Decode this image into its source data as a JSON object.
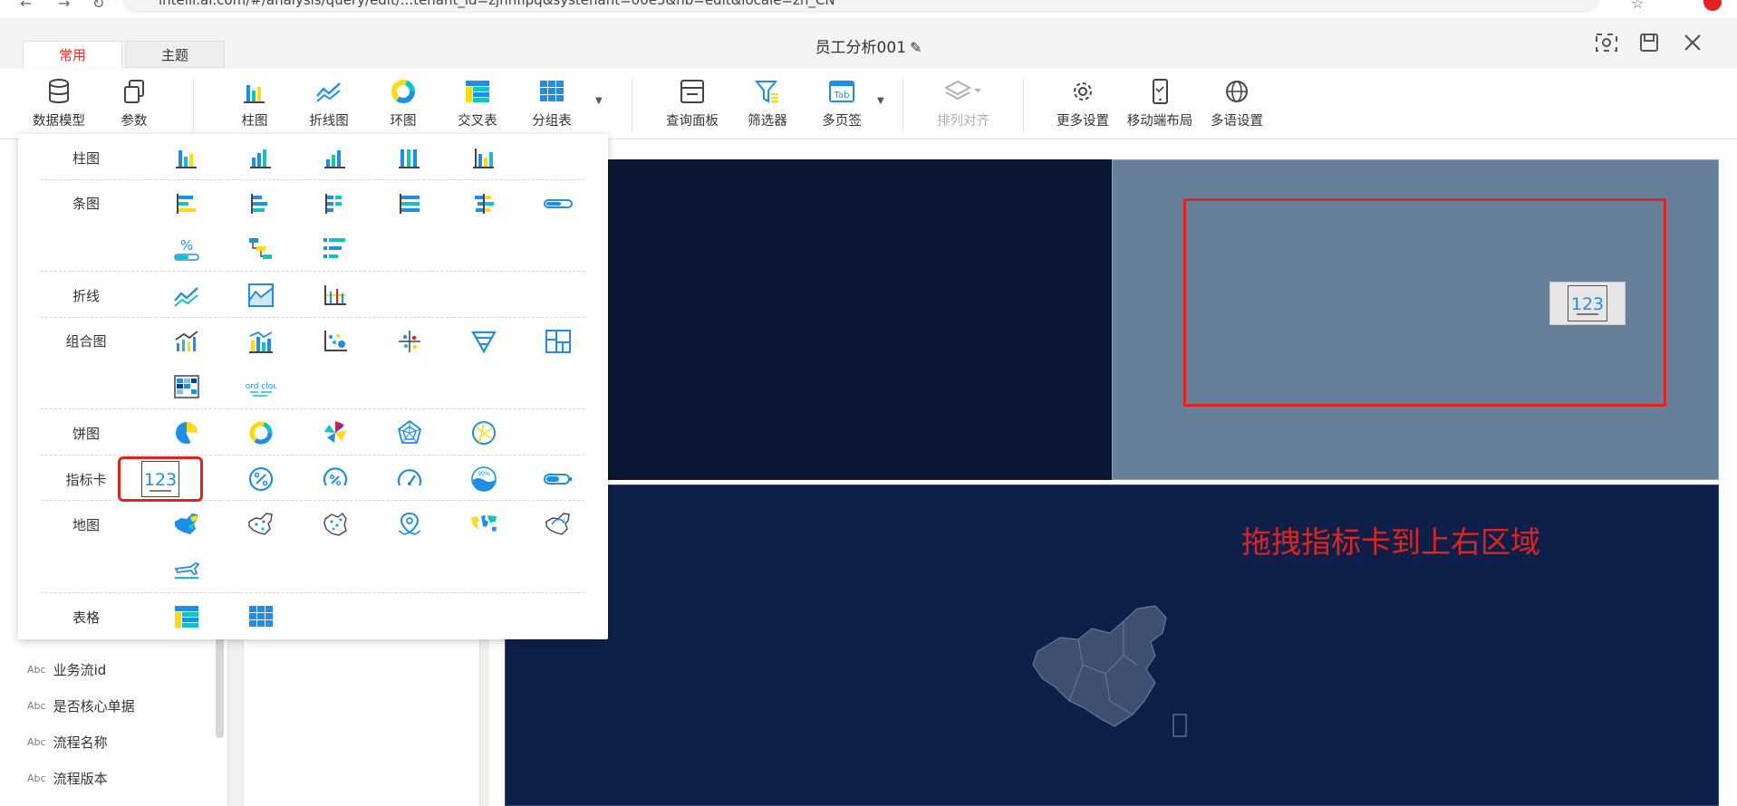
{
  "browser": {
    "url_text": "intelli.ai.com/#/analysis/query/edit/...tenant_id=zjhhfipq&systenant=00e5&nb=edit&locale=zh_CN"
  },
  "tabs": [
    {
      "label": "常用",
      "active": true
    },
    {
      "label": "主题",
      "active": false
    }
  ],
  "title": "员工分析001",
  "toolbar": {
    "items": [
      {
        "label": "数据模型",
        "icon": "database-icon"
      },
      {
        "label": "参数",
        "icon": "copy-icon"
      },
      {
        "label": "柱图",
        "icon": "bar-chart-icon"
      },
      {
        "label": "折线图",
        "icon": "line-chart-icon"
      },
      {
        "label": "环图",
        "icon": "donut-chart-icon"
      },
      {
        "label": "交叉表",
        "icon": "cross-table-icon"
      },
      {
        "label": "分组表",
        "icon": "group-table-icon"
      },
      {
        "label": "查询面板",
        "icon": "query-panel-icon"
      },
      {
        "label": "筛选器",
        "icon": "filter-icon"
      },
      {
        "label": "多页签",
        "icon": "tab-icon"
      },
      {
        "label": "排列对齐",
        "icon": "layers-icon",
        "disabled": true
      },
      {
        "label": "更多设置",
        "icon": "gear-icon"
      },
      {
        "label": "移动端布局",
        "icon": "mobile-icon"
      },
      {
        "label": "多语设置",
        "icon": "globe-icon"
      }
    ],
    "tab_icon_text": "Tab"
  },
  "chart_menu": {
    "categories": [
      {
        "label": "柱图"
      },
      {
        "label": "条图"
      },
      {
        "label": "折线"
      },
      {
        "label": "组合图"
      },
      {
        "label": "饼图"
      },
      {
        "label": "指标卡"
      },
      {
        "label": "地图"
      },
      {
        "label": "表格"
      }
    ],
    "percent_glyph": "%",
    "wordcloud_text": "word cloud",
    "kpi_glyph": "123",
    "gauge_text": "90%"
  },
  "fields": [
    {
      "type": "Abc",
      "name": "业务流id"
    },
    {
      "type": "Abc",
      "name": "是否核心单据"
    },
    {
      "type": "Abc",
      "name": "流程名称"
    },
    {
      "type": "Abc",
      "name": "流程版本"
    }
  ],
  "canvas": {
    "annotation": "拖拽指标卡到上右区域",
    "drag_card_glyph": "123"
  },
  "colors": {
    "accent_red": "#e0231c",
    "icon_blue": "#1e8ee6",
    "icon_cyan": "#13c2c2",
    "icon_yellow": "#fadb14",
    "dark_navy": "#0b1833"
  }
}
